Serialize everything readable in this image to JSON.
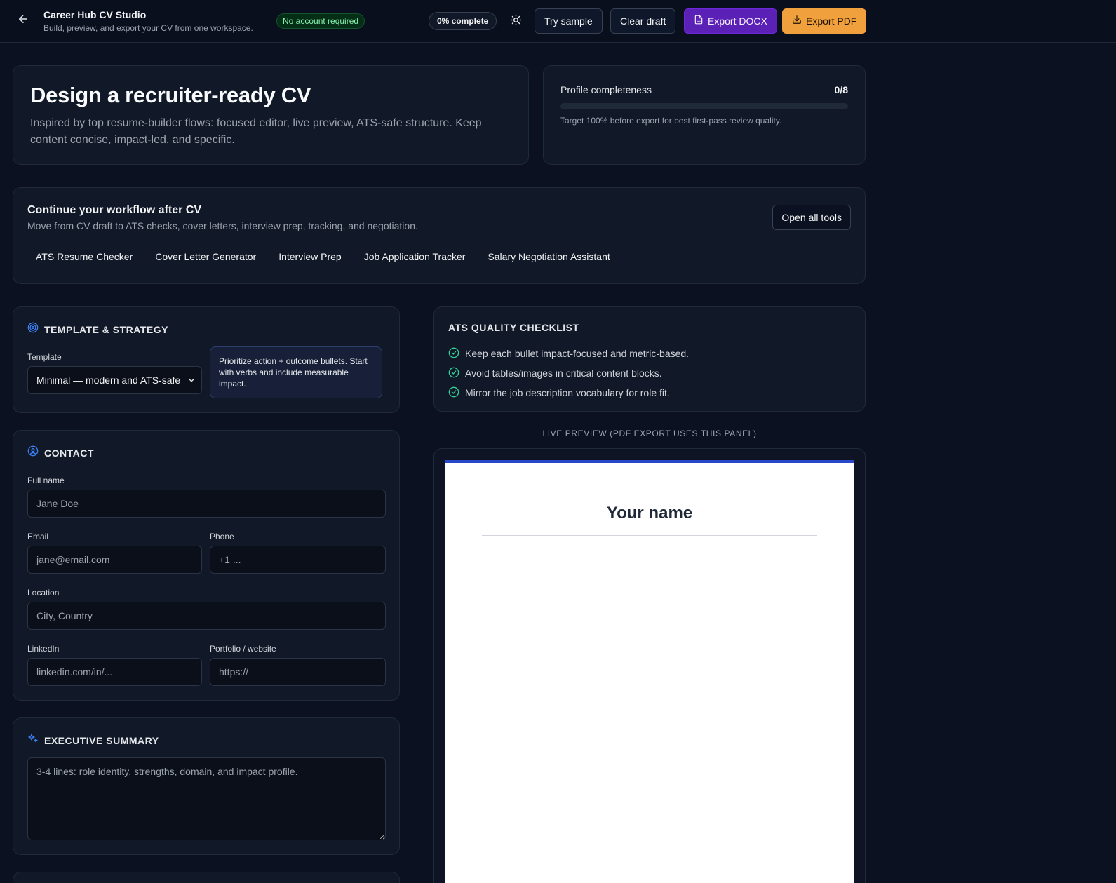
{
  "header": {
    "app_title": "Career Hub CV Studio",
    "app_subtitle": "Build, preview, and export your CV from one workspace.",
    "badge_no_account": "No account required",
    "progress_badge": "0% complete",
    "buttons": {
      "try_sample": "Try sample",
      "clear_draft": "Clear draft",
      "export_docx": "Export DOCX",
      "export_pdf": "Export PDF"
    },
    "icons": [
      "arrow-left-icon",
      "sun-icon",
      "file-icon",
      "download-icon"
    ]
  },
  "hero": {
    "title": "Design a recruiter-ready CV",
    "description": "Inspired by top resume-builder flows: focused editor, live preview, ATS-safe structure. Keep content concise, impact-led, and specific."
  },
  "profile_completeness": {
    "label": "Profile completeness",
    "count": "0/8",
    "progress_fraction": 0,
    "note": "Target 100% before export for best first-pass review quality."
  },
  "workflow": {
    "title": "Continue your workflow after CV",
    "subtitle": "Move from CV draft to ATS checks, cover letters, interview prep, tracking, and negotiation.",
    "open_all": "Open all tools",
    "tools": [
      "ATS Resume Checker",
      "Cover Letter Generator",
      "Interview Prep",
      "Job Application Tracker",
      "Salary Negotiation Assistant"
    ]
  },
  "template_strategy": {
    "title": "TEMPLATE & STRATEGY",
    "template_label": "Template",
    "template_selected": "Minimal — modern and ATS-safe",
    "tip": "Prioritize action + outcome bullets. Start with verbs and include measurable impact."
  },
  "contact": {
    "title": "CONTACT",
    "full_name_label": "Full name",
    "full_name_placeholder": "Jane Doe",
    "email_label": "Email",
    "email_placeholder": "jane@email.com",
    "phone_label": "Phone",
    "phone_placeholder": "+1 ...",
    "location_label": "Location",
    "location_placeholder": "City, Country",
    "linkedin_label": "LinkedIn",
    "linkedin_placeholder": "linkedin.com/in/...",
    "portfolio_label": "Portfolio / website",
    "portfolio_placeholder": "https://"
  },
  "summary": {
    "title": "EXECUTIVE SUMMARY",
    "placeholder": "3-4 lines: role identity, strengths, domain, and impact profile."
  },
  "checklist": {
    "title": "ATS QUALITY CHECKLIST",
    "items": [
      "Keep each bullet impact-focused and metric-based.",
      "Avoid tables/images in critical content blocks.",
      "Mirror the job description vocabulary for role fit."
    ]
  },
  "preview": {
    "label": "LIVE PREVIEW (PDF EXPORT USES THIS PANEL)",
    "name": "Your name"
  },
  "colors": {
    "background": "#0b1120",
    "card": "#111827",
    "accent_purple": "#5b21b6",
    "accent_orange": "#f0a03c",
    "check_green": "#34d399",
    "icon_blue": "#3b82f6",
    "preview_accent": "#2947c9"
  }
}
